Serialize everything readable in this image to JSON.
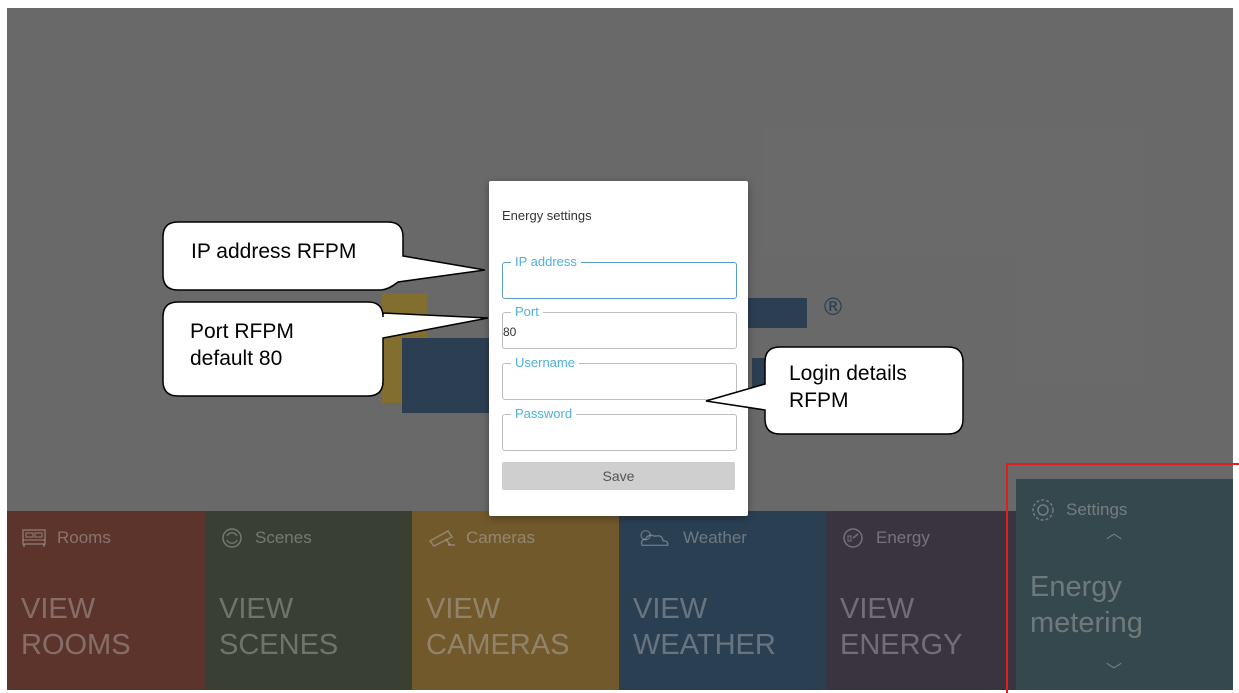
{
  "dialog": {
    "title": "Energy settings",
    "fields": {
      "ip": {
        "label": "IP address",
        "value": ""
      },
      "port": {
        "label": "Port",
        "value": "80"
      },
      "username": {
        "label": "Username",
        "value": ""
      },
      "password": {
        "label": "Password",
        "value": ""
      }
    },
    "save_label": "Save"
  },
  "tiles": {
    "rooms": {
      "header": "Rooms",
      "big": "VIEW\nROOMS",
      "color": "#6b2c1e",
      "icon": "bed-icon"
    },
    "scenes": {
      "header": "Scenes",
      "big": "VIEW\nSCENES",
      "color": "#333c2a",
      "icon": "refresh-icon"
    },
    "cameras": {
      "header": "Cameras",
      "big": "VIEW\nCAMERAS",
      "color": "#8a6520",
      "icon": "camera-icon"
    },
    "weather": {
      "header": "Weather",
      "big": "VIEW\nWEATHER",
      "color": "#1c3d58",
      "icon": "cloud-sun-icon"
    },
    "energy": {
      "header": "Energy",
      "big": "VIEW\nENERGY",
      "color": "#352c3e",
      "icon": "energy-meter-icon"
    },
    "settings": {
      "header": "Settings",
      "big": "Energy\nmetering",
      "color": "#2d4a52",
      "icon": "gear-icon"
    }
  },
  "logo": {
    "registered": "®"
  },
  "callouts": {
    "ip": "IP address RFPM",
    "port_line1": "Port RFPM",
    "port_line2": "default  80",
    "login_line1": "Login details",
    "login_line2": "RFPM"
  }
}
